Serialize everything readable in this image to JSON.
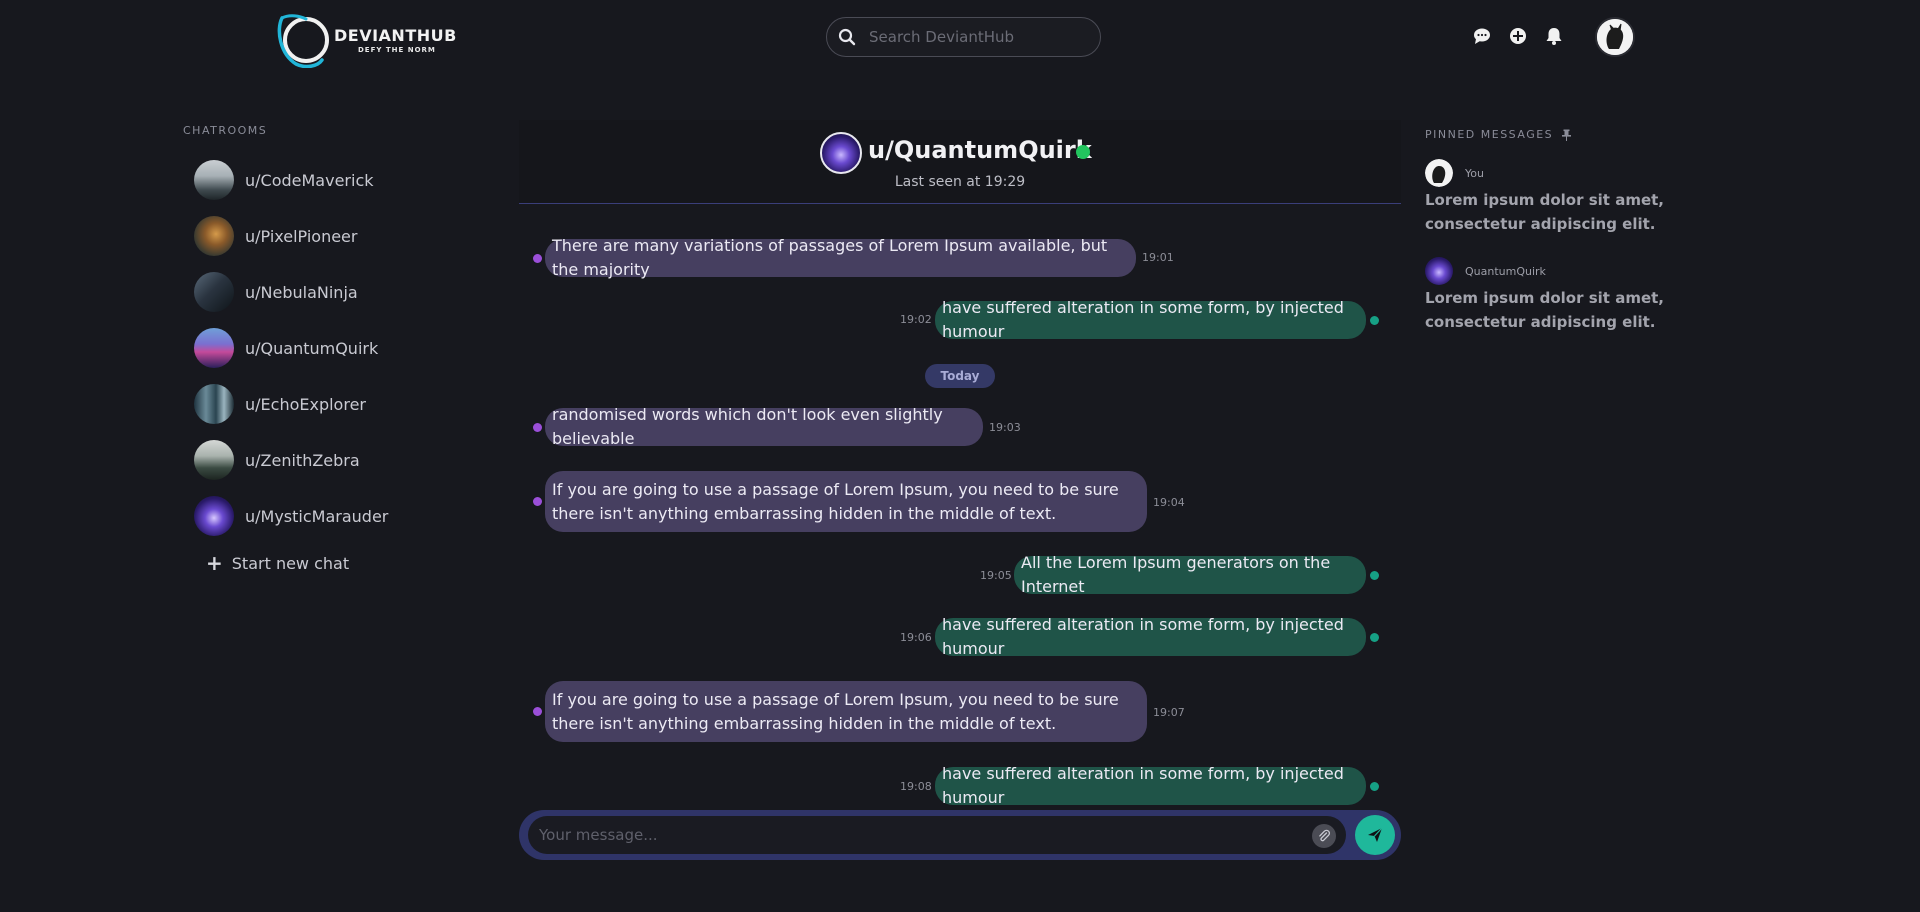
{
  "header": {
    "logo_name": "DEVIANTHUB",
    "logo_tagline": "DEFY THE NORM",
    "search_placeholder": "Search DeviantHub",
    "icons": [
      "chat-icon",
      "add-icon",
      "bell-icon"
    ]
  },
  "sidebar": {
    "title": "CHATROOMS",
    "rooms": [
      {
        "label": "u/CodeMaverick"
      },
      {
        "label": "u/PixelPioneer"
      },
      {
        "label": "u/NebulaNinja"
      },
      {
        "label": "u/QuantumQuirk"
      },
      {
        "label": "u/EchoExplorer"
      },
      {
        "label": "u/ZenithZebra"
      },
      {
        "label": "u/MysticMarauder"
      }
    ],
    "new_chat_label": "Start new chat"
  },
  "chat": {
    "name": "u/QuantumQuirk",
    "status": "Last seen at 19:29",
    "day_separator": "Today",
    "messages": [
      {
        "dir": "in",
        "text": "There are many variations of passages of Lorem Ipsum available, but the majority",
        "time": "19:01"
      },
      {
        "dir": "out",
        "text": "have suffered alteration in some form, by injected humour",
        "time": "19:02"
      },
      {
        "dir": "in",
        "text": "randomised words which don't look even slightly believable",
        "time": "19:03"
      },
      {
        "dir": "in",
        "text": "If you are going to use a passage of Lorem Ipsum, you need to be sure there isn't anything embarrassing hidden in the middle of text.",
        "time": "19:04"
      },
      {
        "dir": "out",
        "text": "All the Lorem Ipsum generators on the Internet",
        "time": "19:05"
      },
      {
        "dir": "out",
        "text": "have suffered alteration in some form, by injected humour",
        "time": "19:06"
      },
      {
        "dir": "in",
        "text": "If you are going to use a passage of Lorem Ipsum, you need to be sure there isn't anything embarrassing hidden in the middle of text.",
        "time": "19:07"
      },
      {
        "dir": "out",
        "text": "have suffered alteration in some form, by injected humour",
        "time": "19:08"
      }
    ],
    "composer_placeholder": "Your message..."
  },
  "pinned": {
    "title": "PINNED MESSAGES",
    "items": [
      {
        "author": "You",
        "text": "Lorem ipsum dolor sit amet, consectetur adipiscing elit."
      },
      {
        "author": "QuantumQuirk",
        "text": "Lorem ipsum dolor sit amet, consectetur adipiscing elit."
      }
    ]
  },
  "colors": {
    "background": "#17181e",
    "incoming_bubble": "#463f60",
    "outgoing_bubble": "#1f5448",
    "accent": "#1fb89b",
    "online": "#22c55e"
  }
}
